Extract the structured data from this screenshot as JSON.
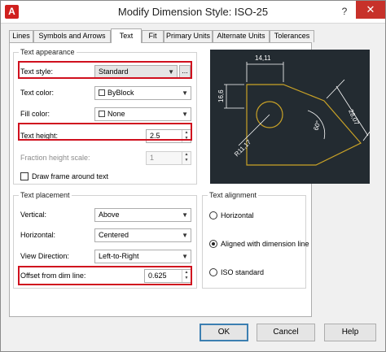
{
  "window": {
    "title": "Modify Dimension Style: ISO-25",
    "app_icon": "A",
    "help_glyph": "?",
    "close_glyph": "✕"
  },
  "tabs": [
    "Lines",
    "Symbols and Arrows",
    "Text",
    "Fit",
    "Primary Units",
    "Alternate Units",
    "Tolerances"
  ],
  "active_tab": "Text",
  "text_appearance": {
    "legend": "Text appearance",
    "text_style": {
      "label": "Text style:",
      "value": "Standard",
      "browse": "..."
    },
    "text_color": {
      "label": "Text color:",
      "value": "ByBlock"
    },
    "fill_color": {
      "label": "Fill color:",
      "value": "None"
    },
    "text_height": {
      "label": "Text height:",
      "value": "2.5"
    },
    "fraction_height_scale": {
      "label": "Fraction height scale:",
      "value": "1"
    },
    "draw_frame": {
      "label": "Draw frame around text",
      "checked": false
    }
  },
  "text_placement": {
    "legend": "Text placement",
    "vertical": {
      "label": "Vertical:",
      "value": "Above"
    },
    "horizontal": {
      "label": "Horizontal:",
      "value": "Centered"
    },
    "view_direction": {
      "label": "View Direction:",
      "value": "Left-to-Right"
    },
    "offset": {
      "label": "Offset from dim line:",
      "value": "0.625"
    }
  },
  "text_alignment": {
    "legend": "Text alignment",
    "options": [
      "Horizontal",
      "Aligned with dimension line",
      "ISO standard"
    ],
    "selected": "Aligned with dimension line"
  },
  "preview": {
    "dims": [
      "14,11",
      "16,6",
      "28,07",
      "60°",
      "R11,17"
    ],
    "line_color": "#ffffff",
    "shape_color": "#c9a227",
    "background": "#232b31"
  },
  "buttons": {
    "ok": "OK",
    "cancel": "Cancel",
    "help": "Help"
  },
  "colors": {
    "highlight": "#d0101e",
    "accent": "#3c7fb1"
  }
}
